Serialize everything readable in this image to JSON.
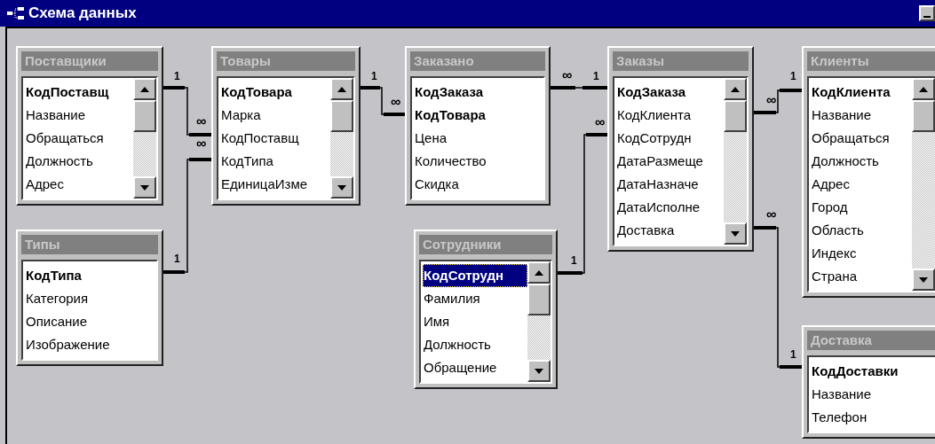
{
  "window": {
    "title": "Схема данных"
  },
  "tables": [
    {
      "title": "Поставщики",
      "scrollbar": true,
      "fields": [
        {
          "name": "КодПоставщ",
          "key": true,
          "selected": false
        },
        {
          "name": "Название",
          "key": false,
          "selected": false
        },
        {
          "name": "Обращаться",
          "key": false,
          "selected": false
        },
        {
          "name": "Должность",
          "key": false,
          "selected": false
        },
        {
          "name": "Адрес",
          "key": false,
          "selected": false
        }
      ]
    },
    {
      "title": "Товары",
      "scrollbar": true,
      "fields": [
        {
          "name": "КодТовара",
          "key": true,
          "selected": false
        },
        {
          "name": "Марка",
          "key": false,
          "selected": false
        },
        {
          "name": "КодПоставщ",
          "key": false,
          "selected": false
        },
        {
          "name": "КодТипа",
          "key": false,
          "selected": false
        },
        {
          "name": "ЕдиницаИзме",
          "key": false,
          "selected": false
        }
      ]
    },
    {
      "title": "Заказано",
      "scrollbar": false,
      "fields": [
        {
          "name": "КодЗаказа",
          "key": true,
          "selected": false
        },
        {
          "name": "КодТовара",
          "key": true,
          "selected": false
        },
        {
          "name": "Цена",
          "key": false,
          "selected": false
        },
        {
          "name": "Количество",
          "key": false,
          "selected": false
        },
        {
          "name": "Скидка",
          "key": false,
          "selected": false
        }
      ]
    },
    {
      "title": "Заказы",
      "scrollbar": true,
      "fields": [
        {
          "name": "КодЗаказа",
          "key": true,
          "selected": false
        },
        {
          "name": "КодКлиента",
          "key": false,
          "selected": false
        },
        {
          "name": "КодСотрудн",
          "key": false,
          "selected": false
        },
        {
          "name": "ДатаРазмеще",
          "key": false,
          "selected": false
        },
        {
          "name": "ДатаНазначе",
          "key": false,
          "selected": false
        },
        {
          "name": "ДатаИсполне",
          "key": false,
          "selected": false
        },
        {
          "name": "Доставка",
          "key": false,
          "selected": false
        }
      ]
    },
    {
      "title": "Клиенты",
      "scrollbar": true,
      "fields": [
        {
          "name": "КодКлиента",
          "key": true,
          "selected": false
        },
        {
          "name": "Название",
          "key": false,
          "selected": false
        },
        {
          "name": "Обращаться",
          "key": false,
          "selected": false
        },
        {
          "name": "Должность",
          "key": false,
          "selected": false
        },
        {
          "name": "Адрес",
          "key": false,
          "selected": false
        },
        {
          "name": "Город",
          "key": false,
          "selected": false
        },
        {
          "name": "Область",
          "key": false,
          "selected": false
        },
        {
          "name": "Индекс",
          "key": false,
          "selected": false
        },
        {
          "name": "Страна",
          "key": false,
          "selected": false
        }
      ]
    },
    {
      "title": "Типы",
      "scrollbar": false,
      "fields": [
        {
          "name": "КодТипа",
          "key": true,
          "selected": false
        },
        {
          "name": "Категория",
          "key": false,
          "selected": false
        },
        {
          "name": "Описание",
          "key": false,
          "selected": false
        },
        {
          "name": "Изображение",
          "key": false,
          "selected": false
        }
      ]
    },
    {
      "title": "Сотрудники",
      "scrollbar": true,
      "fields": [
        {
          "name": "КодСотрудн",
          "key": true,
          "selected": true
        },
        {
          "name": "Фамилия",
          "key": false,
          "selected": false
        },
        {
          "name": "Имя",
          "key": false,
          "selected": false
        },
        {
          "name": "Должность",
          "key": false,
          "selected": false
        },
        {
          "name": "Обращение",
          "key": false,
          "selected": false
        }
      ]
    },
    {
      "title": "Доставка",
      "scrollbar": false,
      "fields": [
        {
          "name": "КодДоставки",
          "key": true,
          "selected": false
        },
        {
          "name": "Название",
          "key": false,
          "selected": false
        },
        {
          "name": "Телефон",
          "key": false,
          "selected": false
        }
      ]
    }
  ],
  "relationships": [
    {
      "one": "1",
      "many": "∞"
    },
    {
      "one": "1",
      "many": "∞"
    },
    {
      "one": "1",
      "many": "∞"
    },
    {
      "one": "1",
      "many": "∞"
    },
    {
      "one": "1",
      "many": "∞"
    },
    {
      "one": "1",
      "many": "∞"
    },
    {
      "one": "1",
      "many": "∞"
    }
  ]
}
